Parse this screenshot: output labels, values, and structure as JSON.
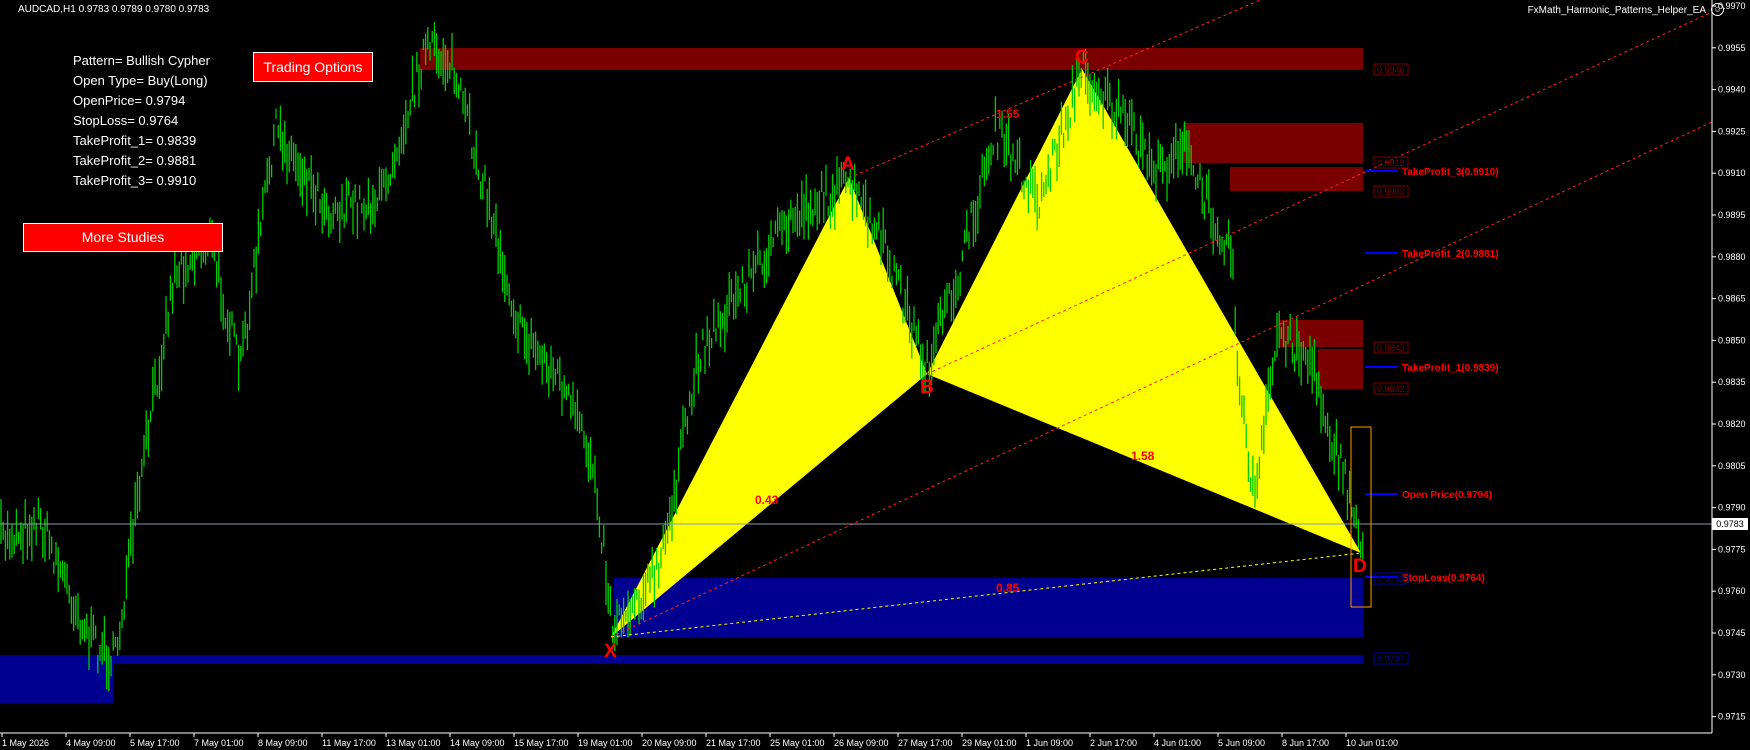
{
  "header": {
    "symbol_line": "AUDCAD,H1  0.9783 0.9789 0.9780 0.9783",
    "ea_name": "FxMath_Harmonic_Patterns_Helper_EA",
    "ea_icon": "smiley-icon"
  },
  "info_panel": {
    "lines": [
      "Pattern= Bullish Cypher",
      "Open Type= Buy(Long)",
      "OpenPrice= 0.9794",
      "StopLoss= 0.9764",
      "TakeProfit_1= 0.9839",
      "TakeProfit_2= 0.9881",
      "TakeProfit_3= 0.9910"
    ]
  },
  "buttons": {
    "trading_options": "Trading Options",
    "more_studies": "More Studies"
  },
  "price_axis": {
    "ticks": [
      "0.9970",
      "0.9955",
      "0.9940",
      "0.9925",
      "0.9910",
      "0.9895",
      "0.9880",
      "0.9865",
      "0.9850",
      "0.9835",
      "0.9820",
      "0.9805",
      "0.9790",
      "0.9775",
      "0.9760",
      "0.9745",
      "0.9730",
      "0.9715"
    ],
    "current_price": "0.9783"
  },
  "time_axis": {
    "labels": [
      "1 May 2026",
      "4 May 09:00",
      "5 May 17:00",
      "7 May 01:00",
      "8 May 09:00",
      "11 May 17:00",
      "13 May 01:00",
      "14 May 09:00",
      "15 May 17:00",
      "19 May 01:00",
      "20 May 09:00",
      "21 May 17:00",
      "25 May 01:00",
      "26 May 09:00",
      "27 May 17:00",
      "29 May 01:00",
      "1 Jun 09:00",
      "2 Jun 17:00",
      "4 Jun 01:00",
      "5 Jun 09:00",
      "8 Jun 17:00",
      "10 Jun 01:00"
    ]
  },
  "pattern": {
    "points": {
      "X": "X",
      "A": "A",
      "B": "B",
      "C": "C",
      "D": "D"
    },
    "ratios": {
      "xa_ab": "0.43",
      "ab_bc": "1.55",
      "bc_cd": "1.58",
      "xd": "0.85"
    }
  },
  "levels": {
    "tp3": "TakeProfit_3(0.9910)",
    "tp2": "TakeProfit_2(0.9881)",
    "tp1": "TakeProfit_1(0.9839)",
    "open": "Open Price(0.9794)",
    "sl": "StopLoss(0.9764)"
  },
  "zone_labels": [
    "0.9946",
    "0.9912",
    "0.9903",
    "0.9843",
    "0.9832",
    "0.9763",
    "0.9737"
  ],
  "colors": {
    "background": "#000000",
    "candles": "#00cc00",
    "pattern_fill": "#ffff00",
    "supply_zone": "#7a0000",
    "demand_zone": "#000090",
    "level_line": "#0000ff",
    "label_red": "#ff0000",
    "entry_box": "#ff9900"
  }
}
